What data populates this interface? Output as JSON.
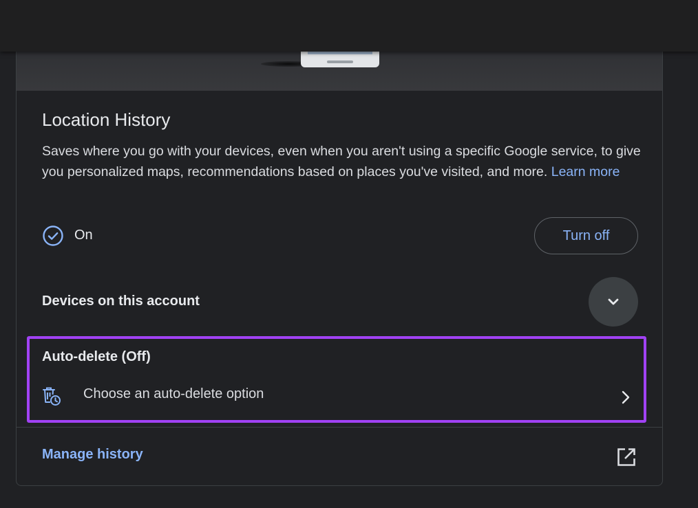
{
  "location_history": {
    "title": "Location History",
    "description": "Saves where you go with your devices, even when you aren't using a specific Google service, to give you personalized maps, recommendations based on places you've visited, and more.",
    "learn_more_label": "Learn more",
    "status_icon": "check-circle-icon",
    "status_label": "On",
    "turn_off_label": "Turn off"
  },
  "devices": {
    "label": "Devices on this account",
    "expand_icon": "chevron-down-icon"
  },
  "auto_delete": {
    "title": "Auto-delete (Off)",
    "option_icon": "auto-delete-icon",
    "option_label": "Choose an auto-delete option",
    "option_chevron": "chevron-right-icon",
    "highlight_color": "#a142f4"
  },
  "manage": {
    "label": "Manage history",
    "icon": "open-in-new-icon"
  },
  "colors": {
    "background": "#202124",
    "link": "#8ab4f8",
    "text": "#e8eaed"
  }
}
